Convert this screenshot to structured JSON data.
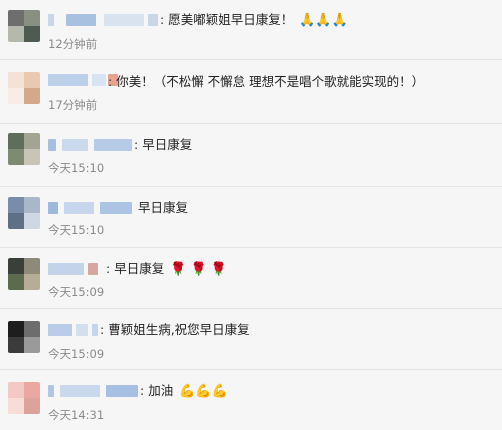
{
  "comments": [
    {
      "text": "愿美嘟颖姐早日康复！",
      "emoji": "🙏🙏🙏",
      "time": "12分钟前",
      "avatar_colors": [
        "#6e6e6e",
        "#8a8f84",
        "#b4b8ad",
        "#4f5a52"
      ],
      "name_colors": [
        "#c9d6e8",
        "#a9c1e0",
        "#d9e3ef"
      ]
    },
    {
      "text": "你美！（不松懈 不懈怠 理想不是唱个歌就能实现的！）",
      "emoji": "",
      "time": "17分钟前",
      "avatar_colors": [
        "#f3e3d6",
        "#e9c9b0",
        "#f7ede6",
        "#d4a98a"
      ],
      "name_colors": [
        "#bcd0ea",
        "#d9e4f2",
        "#c6d8ee"
      ]
    },
    {
      "text": "早日康复",
      "emoji": "",
      "time": "今天15:10",
      "avatar_colors": [
        "#5f6e5a",
        "#a4a493",
        "#7e8a72",
        "#c9c5b6"
      ],
      "name_colors": [
        "#a8bfe0",
        "#cbd9ec",
        "#b7cbe6"
      ]
    },
    {
      "text": "早日康复",
      "emoji": "",
      "time": "今天15:10",
      "avatar_colors": [
        "#7a8ca8",
        "#aab7c9",
        "#5e6f86",
        "#cfd7e2"
      ],
      "name_colors": [
        "#9db8de",
        "#c7d6ec",
        "#adc4e4"
      ]
    },
    {
      "text": "早日康复",
      "emoji": "🌹 🌹 🌹",
      "time": "今天15:09",
      "avatar_colors": [
        "#3a3f3a",
        "#8e8a7a",
        "#5c6a4e",
        "#b5ad98"
      ],
      "name_colors": [
        "#c2d3ea",
        "#d6a7a0",
        "#b4c9e6"
      ]
    },
    {
      "text": "曹颖姐生病,祝您早日康复",
      "emoji": "",
      "time": "今天15:09",
      "avatar_colors": [
        "#1e1e1e",
        "#6d6d6d",
        "#3b3b3b",
        "#9a9a9a"
      ],
      "name_colors": [
        "#b9cde8",
        "#d2dfef",
        "#c4d5ec"
      ]
    },
    {
      "text": "加油",
      "emoji": "💪💪💪",
      "time": "今天14:31",
      "avatar_colors": [
        "#f2c9c4",
        "#e9a9a2",
        "#f7dcd8",
        "#dba39b"
      ],
      "name_colors": [
        "#b0c6e4",
        "#c9d8ed",
        "#a6bfe2"
      ]
    }
  ]
}
